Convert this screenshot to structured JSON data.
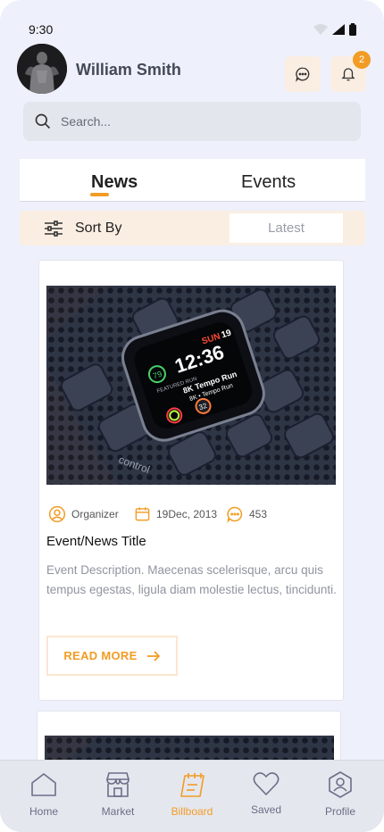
{
  "status_bar": {
    "time": "9:30"
  },
  "header": {
    "user_name": "William Smith",
    "notification_count": "2"
  },
  "search": {
    "placeholder": "Search..."
  },
  "tabs": [
    {
      "label": "News",
      "active": true
    },
    {
      "label": "Events",
      "active": false
    }
  ],
  "sort": {
    "label": "Sort By",
    "selected": "Latest"
  },
  "cards": [
    {
      "organizer": "Organizer",
      "date": "19Dec, 2013",
      "comments": "453",
      "title": "Event/News Title",
      "description": "Event Description. Maecenas scelerisque, arcu quis tempus egestas, ligula diam molestie lectus, tincidunti.",
      "read_more": "READ MORE",
      "watch_face": {
        "day": "SUN 19",
        "time": "12:36",
        "line1": "FEATURED RUN",
        "line2": "8K Tempo Run",
        "line3": "8K • Tempo Run",
        "badge": "32"
      }
    }
  ],
  "bottom_nav": [
    {
      "label": "Home",
      "icon": "home-icon"
    },
    {
      "label": "Market",
      "icon": "market-icon"
    },
    {
      "label": "Billboard",
      "icon": "billboard-icon",
      "active": true
    },
    {
      "label": "Saved",
      "icon": "heart-icon"
    },
    {
      "label": "Profile",
      "icon": "profile-icon"
    }
  ],
  "colors": {
    "accent": "#f29c25",
    "accent_light": "#faeee3",
    "background": "#eef0fb",
    "nav_text": "#6b6e88"
  }
}
